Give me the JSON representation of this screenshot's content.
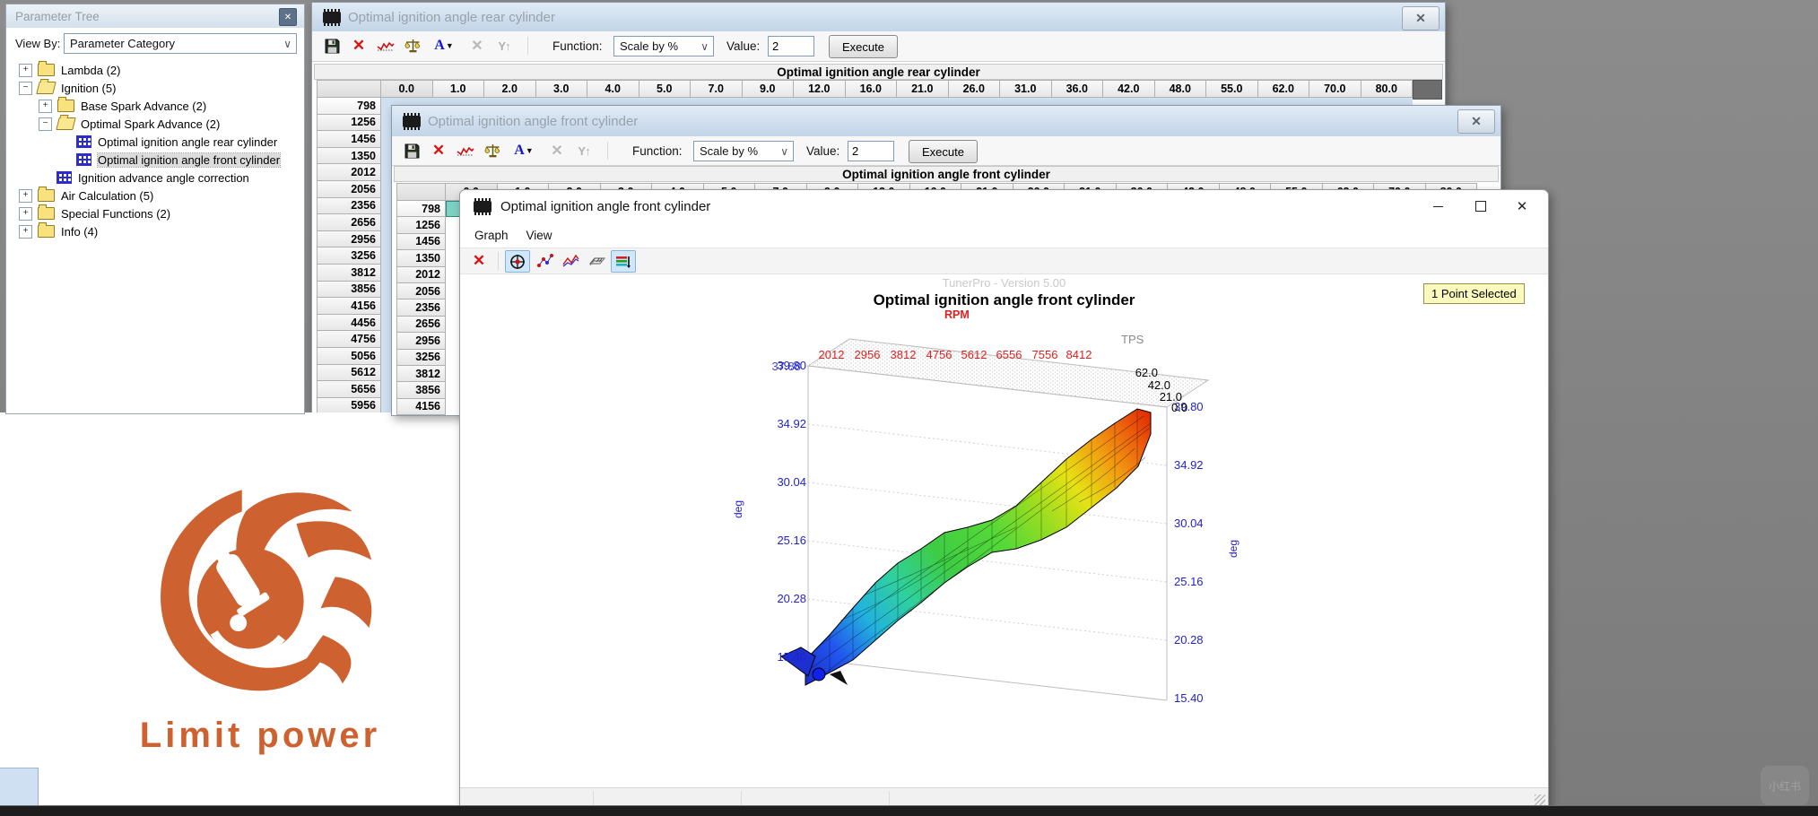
{
  "glyphs": {
    "close_x": "✕",
    "chevron_down": "∨",
    "dropdown_arrow": "▼",
    "y_flip": "Y↑",
    "a_compare": "A"
  },
  "parameter_tree": {
    "title": "Parameter Tree",
    "view_by_label": "View By:",
    "view_by_value": "Parameter Category",
    "items": [
      {
        "expander": "+",
        "label": "Lambda  (2)"
      },
      {
        "expander": "−",
        "label": "Ignition (5)"
      },
      {
        "expander": "+",
        "label": "Base Spark Advance (2)"
      },
      {
        "expander": "−",
        "label": "Optimal Spark Advance (2)"
      },
      {
        "expander": "",
        "label": "Optimal ignition angle rear cylinder"
      },
      {
        "expander": "",
        "label": "Optimal ignition angle front cylinder"
      },
      {
        "expander": "",
        "label": "Ignition advance angle correction"
      },
      {
        "expander": "+",
        "label": "Air Calculation (5)"
      },
      {
        "expander": "+",
        "label": "Special Functions (2)"
      },
      {
        "expander": "+",
        "label": "Info (4)"
      }
    ]
  },
  "rear_window": {
    "title": "Optimal ignition angle rear cylinder",
    "function_label": "Function:",
    "function_value": "Scale by %",
    "value_label": "Value:",
    "value": "2",
    "execute_label": "Execute",
    "table_title": "Optimal ignition angle rear cylinder",
    "col_headers": [
      "0.0",
      "1.0",
      "2.0",
      "3.0",
      "4.0",
      "5.0",
      "7.0",
      "9.0",
      "12.0",
      "16.0",
      "21.0",
      "26.0",
      "31.0",
      "36.0",
      "42.0",
      "48.0",
      "55.0",
      "62.0",
      "70.0",
      "80.0"
    ],
    "row_headers": [
      "798",
      "1256",
      "1456",
      "1350",
      "2012",
      "2056",
      "2356",
      "2656",
      "2956",
      "3256",
      "3812",
      "3856",
      "4156",
      "4456",
      "4756",
      "5056",
      "5612",
      "5656",
      "5956"
    ]
  },
  "front_window": {
    "title": "Optimal ignition angle front cylinder",
    "function_label": "Function:",
    "function_value": "Scale by %",
    "value_label": "Value:",
    "value": "2",
    "execute_label": "Execute",
    "table_title": "Optimal ignition angle front cylinder",
    "col_headers": [
      "0.0",
      "1.0",
      "2.0",
      "3.0",
      "4.0",
      "5.0",
      "7.0",
      "9.0",
      "12.0",
      "16.0",
      "21.0",
      "26.0",
      "31.0",
      "36.0",
      "42.0",
      "48.0",
      "55.0",
      "62.0",
      "70.0",
      "80.0"
    ],
    "row_headers": [
      "798",
      "1256",
      "1456",
      "1350",
      "2012",
      "2056",
      "2356",
      "2656",
      "2956",
      "3256",
      "3812",
      "3856",
      "4156"
    ]
  },
  "graph_window": {
    "title": "Optimal ignition angle front cylinder",
    "menu": [
      "Graph",
      "View"
    ],
    "watermark": "TunerPro - Version 5.00",
    "chart_title": "Optimal ignition angle front cylinder",
    "points_selected_badge": "1 Point Selected"
  },
  "chart_data": {
    "type": "surface",
    "title": "Optimal ignition angle front cylinder",
    "x_axis": {
      "label": "RPM",
      "label_color": "#e02020",
      "ticks": [
        "2012",
        "2956",
        "3812",
        "4756",
        "5612",
        "6556",
        "7556",
        "8412"
      ]
    },
    "y_axis": {
      "label": "TPS",
      "ticks": [
        "0.0",
        "21.0",
        "42.0",
        "62.0"
      ]
    },
    "z_axis": {
      "label": "deg",
      "label_color": "#2222cc",
      "ticks_top_to_bottom": [
        "39.80",
        "34.92",
        "30.04",
        "25.16",
        "20.28",
        "15.40"
      ],
      "overlap_label_top_left": "37.88"
    },
    "zlim": [
      15.4,
      39.8
    ],
    "selected_points": 1,
    "description": "3D surface of optimal ignition advance (deg) vs RPM and TPS; rises from ~15.4 deg (blue, low RPM/low TPS) to ~39.8 deg (red, high RPM); one selected point (blue dot) near low RPM/low TPS"
  },
  "logo": {
    "text": "Limit power",
    "color": "#cd6130"
  },
  "desktop": {
    "xiaohongshu_watermark": "小红书"
  }
}
